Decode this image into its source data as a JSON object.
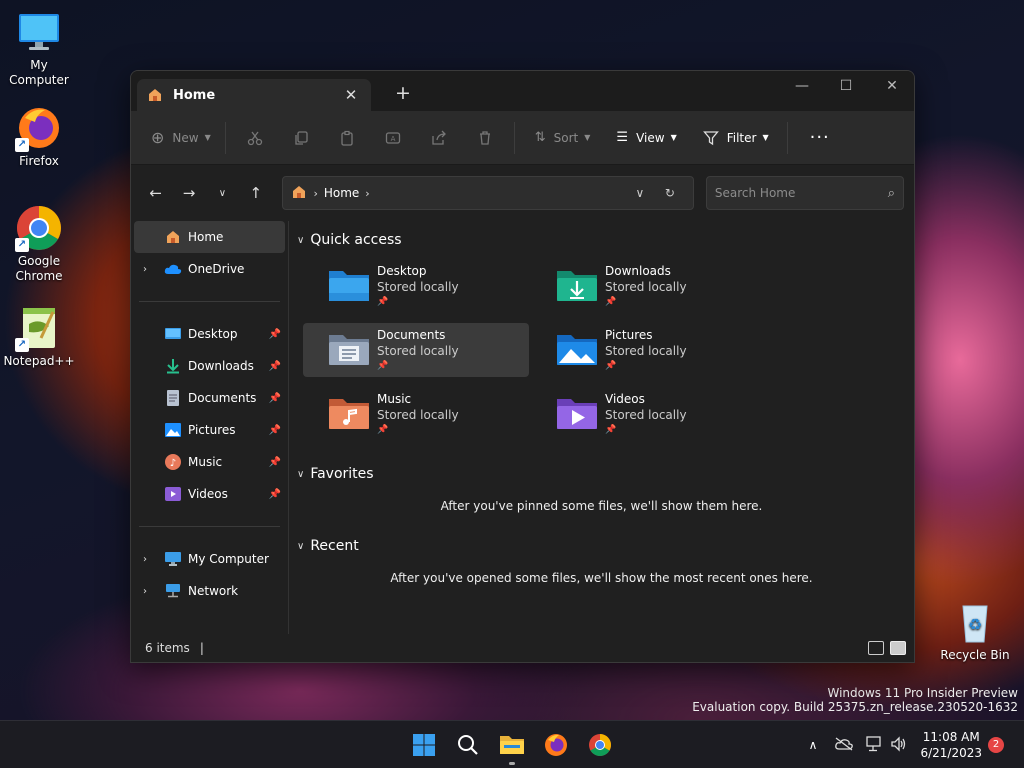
{
  "desktop": {
    "icons": [
      {
        "label": "My Computer"
      },
      {
        "label": "Firefox"
      },
      {
        "label": "Google Chrome"
      },
      {
        "label": "Notepad++"
      }
    ],
    "recycle_bin": "Recycle Bin",
    "watermark": {
      "line1": "Windows 11 Pro Insider Preview",
      "line2": "Evaluation copy. Build 25375.zn_release.230520-1632"
    }
  },
  "window": {
    "tab_title": "Home",
    "toolbar": {
      "new_label": "New",
      "sort_label": "Sort",
      "view_label": "View",
      "filter_label": "Filter"
    },
    "address": {
      "crumb": "Home"
    },
    "search": {
      "placeholder": "Search Home"
    },
    "sidebar": {
      "home": "Home",
      "onedrive": "OneDrive",
      "pinned": [
        {
          "label": "Desktop"
        },
        {
          "label": "Downloads"
        },
        {
          "label": "Documents"
        },
        {
          "label": "Pictures"
        },
        {
          "label": "Music"
        },
        {
          "label": "Videos"
        }
      ],
      "my_computer": "My Computer",
      "network": "Network"
    },
    "quick_access": {
      "title": "Quick access",
      "items": [
        {
          "name": "Desktop",
          "sub": "Stored locally"
        },
        {
          "name": "Downloads",
          "sub": "Stored locally"
        },
        {
          "name": "Documents",
          "sub": "Stored locally"
        },
        {
          "name": "Pictures",
          "sub": "Stored locally"
        },
        {
          "name": "Music",
          "sub": "Stored locally"
        },
        {
          "name": "Videos",
          "sub": "Stored locally"
        }
      ]
    },
    "favorites": {
      "title": "Favorites",
      "empty": "After you've pinned some files, we'll show them here."
    },
    "recent": {
      "title": "Recent",
      "empty": "After you've opened some files, we'll show the most recent ones here."
    },
    "status": {
      "count": "6 items"
    }
  },
  "taskbar": {
    "clock_time": "11:08 AM",
    "clock_date": "6/21/2023",
    "notification_count": "2"
  },
  "colors": {
    "accent": "#0078d4",
    "folder_blue": "#3b9de8",
    "folder_teal": "#1fa88a",
    "folder_gray": "#8e9cb0",
    "folder_orange": "#e07a4a",
    "folder_purple": "#8b5cd6"
  }
}
